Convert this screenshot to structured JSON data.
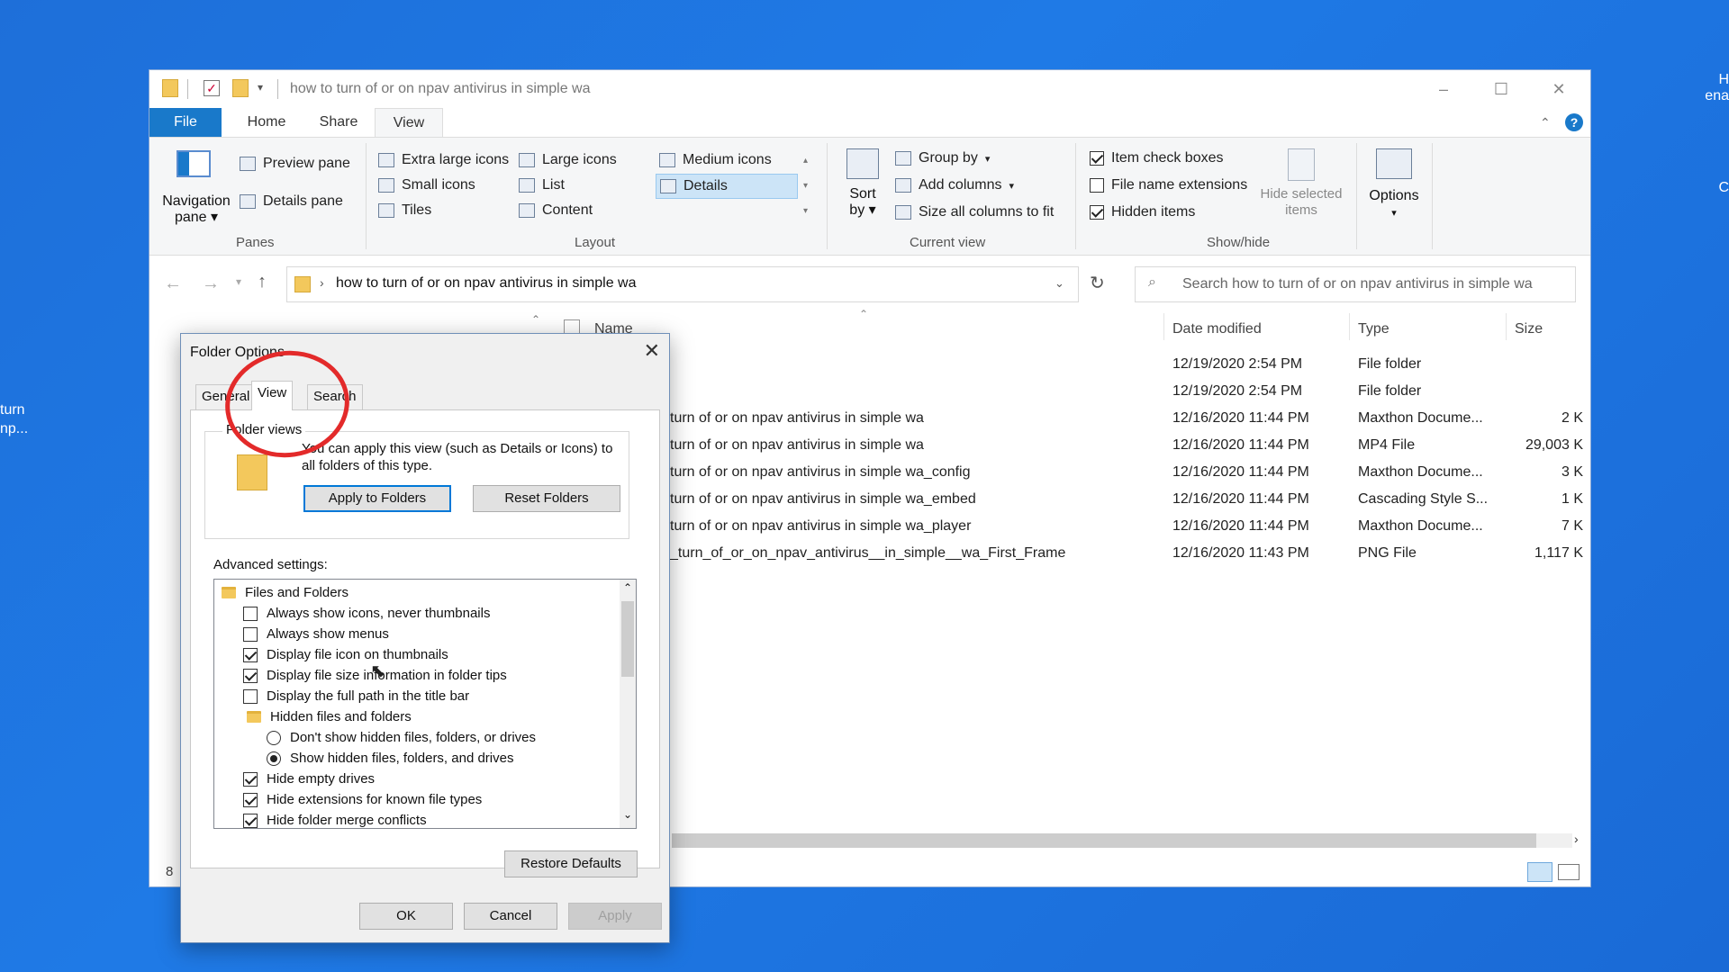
{
  "desktop": {
    "right_text_1": "H",
    "right_text_2": "ena",
    "right_text_3": "C",
    "left_text_1": "turn",
    "left_text_2": "np..."
  },
  "explorer": {
    "title": "how to turn of or on npav antivirus  in simple  wa",
    "ribbon_tabs": [
      "File",
      "Home",
      "Share",
      "View"
    ],
    "panes": {
      "navigation_pane": "Navigation pane",
      "preview_pane": "Preview pane",
      "details_pane": "Details pane",
      "group_label": "Panes"
    },
    "layout": {
      "extra_large": "Extra large icons",
      "large": "Large icons",
      "medium": "Medium icons",
      "small": "Small icons",
      "list": "List",
      "details": "Details",
      "tiles": "Tiles",
      "content": "Content",
      "group_label": "Layout"
    },
    "current_view": {
      "sort_by": "Sort by",
      "group_by": "Group by",
      "add_columns": "Add columns",
      "size_all": "Size all columns to fit",
      "group_label": "Current view"
    },
    "show_hide": {
      "item_check_boxes": "Item check boxes",
      "file_name_extensions": "File name extensions",
      "hidden_items": "Hidden items",
      "hide_selected": "Hide selected items",
      "group_label": "Show/hide"
    },
    "options": "Options",
    "address": "how to turn of or on npav antivirus  in simple  wa",
    "search_placeholder": "Search how to turn of or on npav antivirus  in simple  wa",
    "columns": {
      "name": "Name",
      "date": "Date modified",
      "type": "Type",
      "size": "Size"
    },
    "files": [
      {
        "name": "",
        "date": "12/19/2020 2:54 PM",
        "type": "File folder",
        "size": ""
      },
      {
        "name": "",
        "date": "12/19/2020 2:54 PM",
        "type": "File folder",
        "size": ""
      },
      {
        "name": "turn of or on npav antivirus  in simple  wa",
        "date": "12/16/2020 11:44 PM",
        "type": "Maxthon Docume...",
        "size": "2 K"
      },
      {
        "name": "turn of or on npav antivirus  in simple  wa",
        "date": "12/16/2020 11:44 PM",
        "type": "MP4 File",
        "size": "29,003 K"
      },
      {
        "name": "turn of or on npav antivirus  in simple  wa_config",
        "date": "12/16/2020 11:44 PM",
        "type": "Maxthon Docume...",
        "size": "3 K"
      },
      {
        "name": "turn of or on npav antivirus  in simple  wa_embed",
        "date": "12/16/2020 11:44 PM",
        "type": "Cascading Style S...",
        "size": "1 K"
      },
      {
        "name": "turn of or on npav antivirus  in simple  wa_player",
        "date": "12/16/2020 11:44 PM",
        "type": "Maxthon Docume...",
        "size": "7 K"
      },
      {
        "name": "_turn_of_or_on_npav_antivirus__in_simple__wa_First_Frame",
        "date": "12/16/2020 11:43 PM",
        "type": "PNG File",
        "size": "1,117 K"
      }
    ],
    "status_count": "8"
  },
  "dialog": {
    "title": "Folder Options",
    "tabs": [
      "General",
      "View",
      "Search"
    ],
    "folder_views_label": "Folder views",
    "folder_views_text": "You can apply this view (such as Details or Icons) to all folders of this type.",
    "apply_to_folders": "Apply to Folders",
    "reset_folders": "Reset Folders",
    "advanced_label": "Advanced settings:",
    "tree": [
      {
        "kind": "folder",
        "label": "Files and Folders"
      },
      {
        "kind": "check",
        "checked": false,
        "label": "Always show icons, never thumbnails"
      },
      {
        "kind": "check",
        "checked": false,
        "label": "Always show menus"
      },
      {
        "kind": "check",
        "checked": true,
        "label": "Display file icon on thumbnails"
      },
      {
        "kind": "check",
        "checked": true,
        "label": "Display file size information in folder tips"
      },
      {
        "kind": "check",
        "checked": false,
        "label": "Display the full path in the title bar"
      },
      {
        "kind": "folder",
        "label": "Hidden files and folders"
      },
      {
        "kind": "radio",
        "checked": false,
        "label": "Don't show hidden files, folders, or drives"
      },
      {
        "kind": "radio",
        "checked": true,
        "label": "Show hidden files, folders, and drives"
      },
      {
        "kind": "check",
        "checked": true,
        "label": "Hide empty drives"
      },
      {
        "kind": "check",
        "checked": true,
        "label": "Hide extensions for known file types"
      },
      {
        "kind": "check",
        "checked": true,
        "label": "Hide folder merge conflicts"
      }
    ],
    "restore_defaults": "Restore Defaults",
    "ok": "OK",
    "cancel": "Cancel",
    "apply": "Apply"
  }
}
